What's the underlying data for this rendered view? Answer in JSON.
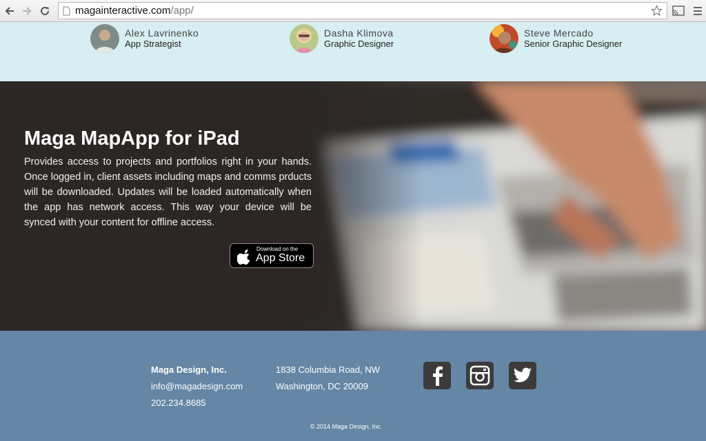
{
  "browser": {
    "url_host": "magainteractive.com",
    "url_path": "/app/"
  },
  "team": [
    {
      "name": "Alex Lavrinenko",
      "role": "App Strategist"
    },
    {
      "name": "Dasha Klimova",
      "role": "Graphic Designer"
    },
    {
      "name": "Steve Mercado",
      "role": "Senior Graphic Designer"
    }
  ],
  "hero": {
    "title": "Maga MapApp for iPad",
    "body": "Provides access to projects and portfolios right in your hands. Once logged in, client assets including maps and comms prducts will be downloaded. Updates will be loaded automatically when the app has network access. This way your device will be synced with your content for offline access.",
    "badge_small": "Download on the",
    "badge_big": "App Store"
  },
  "footer": {
    "company": "Maga Design, Inc.",
    "email": "info@magadesign.com",
    "phone": "202.234.8685",
    "address_line1": "1838 Columbia Road, NW",
    "address_line2": "Washington, DC 20009",
    "social": [
      "facebook-icon",
      "instagram-icon",
      "twitter-icon"
    ],
    "copyright": "© 2014 Maga Design, Inc."
  },
  "colors": {
    "team_bg": "#d7eef2",
    "footer_bg": "#6586a5",
    "social_bg": "#3b3b3b"
  }
}
